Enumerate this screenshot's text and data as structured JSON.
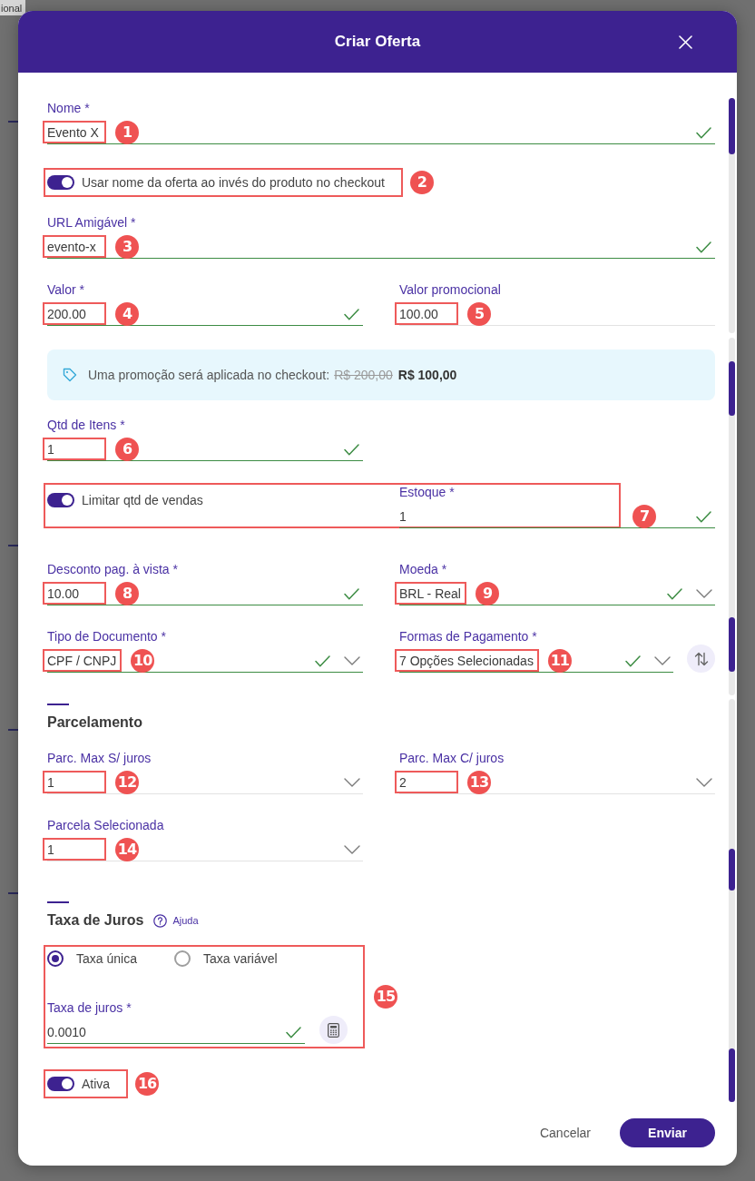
{
  "backdrop": {
    "text": "ional"
  },
  "dialog": {
    "title": "Criar Oferta"
  },
  "form": {
    "name": {
      "label": "Nome *",
      "value": "Evento X",
      "valid": true,
      "marker": "1"
    },
    "offer_name_toggle": {
      "label": "Usar nome da oferta ao invés do produto no checkout",
      "on": true,
      "marker": "2"
    },
    "url": {
      "label": "URL Amigável *",
      "value": "evento-x",
      "valid": true,
      "marker": "3"
    },
    "price": {
      "label": "Valor *",
      "value": "200.00",
      "valid": true,
      "marker": "4"
    },
    "promo_price": {
      "label": "Valor promocional",
      "value": "100.00",
      "valid": false,
      "marker": "5"
    },
    "promo_notice": {
      "text": "Uma promoção será aplicada no checkout:",
      "old_price": "R$ 200,00",
      "new_price": "R$ 100,00"
    },
    "item_qty": {
      "label": "Qtd de Itens *",
      "value": "1",
      "valid": true,
      "marker": "6"
    },
    "limit_sales": {
      "label": "Limitar qtd de vendas",
      "on": true,
      "stock": {
        "label": "Estoque *",
        "value": "1",
        "valid": true
      },
      "marker": "7"
    },
    "cash_discount": {
      "label": "Desconto pag. à vista *",
      "value": "10.00",
      "valid": true,
      "marker": "8"
    },
    "currency": {
      "label": "Moeda *",
      "value": "BRL - Real",
      "valid": true,
      "marker": "9"
    },
    "document_type": {
      "label": "Tipo de Documento *",
      "value": "CPF / CNPJ",
      "valid": true,
      "marker": "10"
    },
    "payment_methods": {
      "label": "Formas de Pagamento *",
      "value": "7 Opções Selecionadas",
      "valid": true,
      "marker": "11"
    },
    "installments": {
      "heading": "Parcelamento",
      "max_no_interest": {
        "label": "Parc. Max S/ juros",
        "value": "1",
        "valid": false,
        "marker": "12"
      },
      "max_with_interest": {
        "label": "Parc. Max C/ juros",
        "value": "2",
        "valid": false,
        "marker": "13"
      },
      "selected_installment": {
        "label": "Parcela Selecionada",
        "value": "1",
        "valid": false,
        "marker": "14"
      }
    },
    "interest": {
      "heading": "Taxa de Juros",
      "help": "Ajuda",
      "rate_types": [
        {
          "label": "Taxa única",
          "selected": true
        },
        {
          "label": "Taxa variável",
          "selected": false
        }
      ],
      "rate": {
        "label": "Taxa de juros *",
        "value": "0.0010",
        "valid": true
      },
      "marker": "15"
    },
    "active": {
      "label": "Ativa",
      "on": true,
      "marker": "16"
    }
  },
  "actions": {
    "cancel": "Cancelar",
    "submit": "Enviar"
  }
}
